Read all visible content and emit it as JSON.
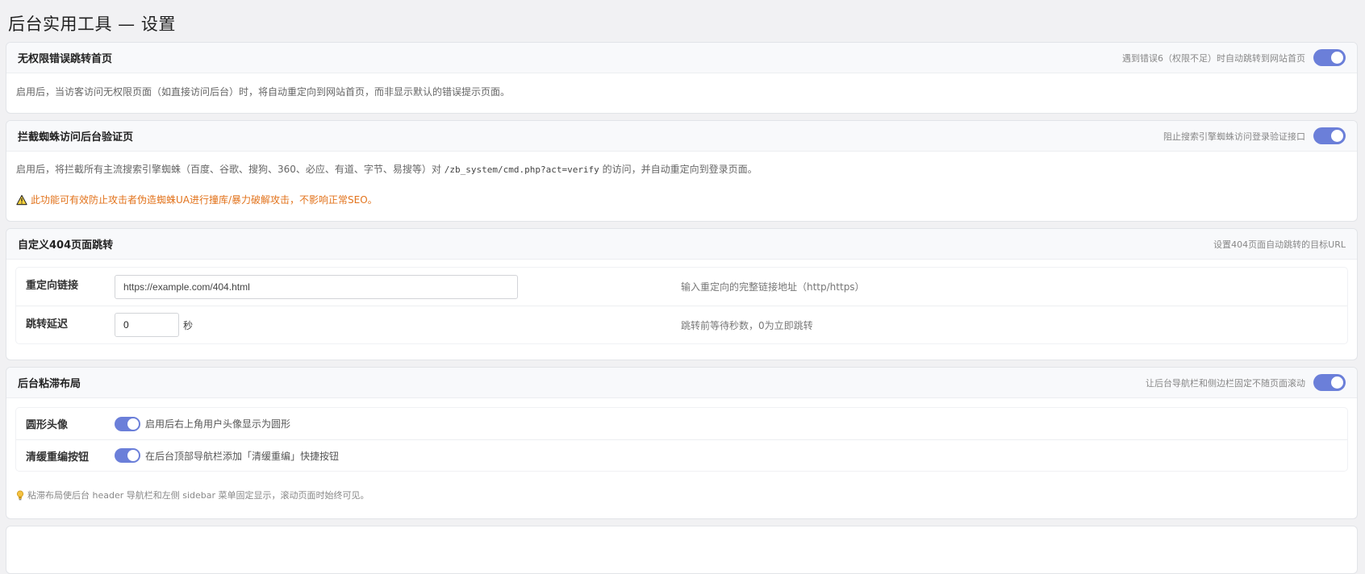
{
  "page": {
    "title": "后台实用工具 — 设置"
  },
  "cards": {
    "noperm": {
      "title": "无权限错误跳转首页",
      "hint": "遇到错误6（权限不足）时自动跳转到网站首页",
      "enabled": true,
      "desc": "启用后，当访客访问无权限页面（如直接访问后台）时，将自动重定向到网站首页，而非显示默认的错误提示页面。"
    },
    "spider": {
      "title": "拦截蜘蛛访问后台验证页",
      "hint": "阻止搜索引擎蜘蛛访问登录验证接口",
      "enabled": true,
      "desc_before": "启用后，将拦截所有主流搜索引擎蜘蛛（百度、谷歌、搜狗、360、必应、有道、字节、易搜等）对",
      "desc_code": "/zb_system/cmd.php?act=verify",
      "desc_after": "的访问，并自动重定向到登录页面。",
      "warning": "此功能可有效防止攻击者伪造蜘蛛UA进行撞库/暴力破解攻击，不影响正常SEO。",
      "warning_color": "#e2731c"
    },
    "redirect404": {
      "title": "自定义404页面跳转",
      "hint": "设置404页面自动跳转的目标URL",
      "rows": {
        "url": {
          "label": "重定向链接",
          "value": "https://example.com/404.html",
          "help": "输入重定向的完整链接地址（http/https）"
        },
        "delay": {
          "label": "跳转延迟",
          "value": "0",
          "unit": "秒",
          "help": "跳转前等待秒数，0为立即跳转"
        }
      }
    },
    "sticky": {
      "title": "后台粘滞布局",
      "hint": "让后台导航栏和侧边栏固定不随页面滚动",
      "enabled": true,
      "rows": {
        "round_avatar": {
          "label": "圆形头像",
          "enabled": true,
          "text": "启用后右上角用户头像显示为圆形"
        },
        "cache_button": {
          "label": "清缓重编按钮",
          "enabled": true,
          "text": "在后台顶部导航栏添加「清缓重编」快捷按钮"
        }
      },
      "tip": "粘滞布局使后台 header 导航栏和左侧 sidebar 菜单固定显示，滚动页面时始终可见。"
    }
  },
  "colors": {
    "toggle_on": "#6b7fd9",
    "background": "#f1f1f3"
  }
}
